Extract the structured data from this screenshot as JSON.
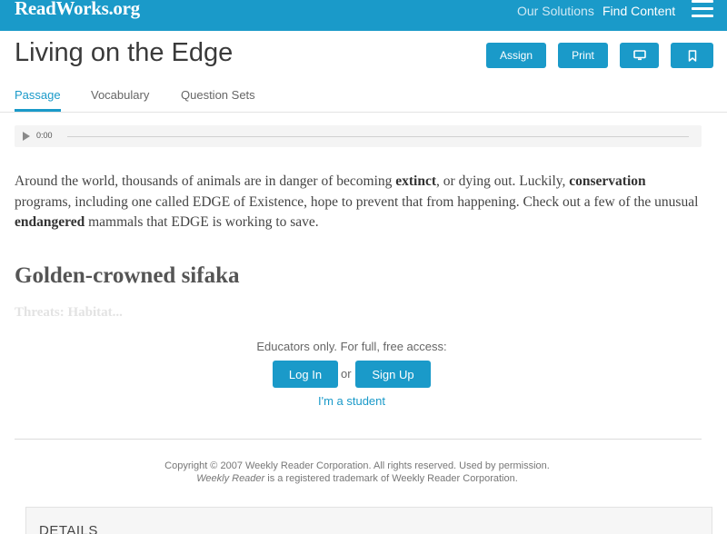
{
  "header": {
    "logo": "ReadWorks.org",
    "nav": {
      "solutions": "Our Solutions",
      "find_content": "Find Content"
    },
    "menu_icon": "hamburger-menu-icon"
  },
  "page": {
    "title": "Living on the Edge",
    "actions": {
      "assign": "Assign",
      "print": "Print",
      "present_icon": "monitor-icon",
      "bookmark_icon": "bookmark-icon"
    }
  },
  "tabs": [
    {
      "label": "Passage",
      "active": true
    },
    {
      "label": "Vocabulary",
      "active": false
    },
    {
      "label": "Question Sets",
      "active": false
    }
  ],
  "audio": {
    "time": "0:00",
    "play_icon": "play-icon"
  },
  "passage": {
    "p1": "Around the world, thousands of animals are in danger of becoming ",
    "k1": "extinct",
    "p2": ", or dying out. Luckily, ",
    "k2": "conservation",
    "p3": " programs, including one called EDGE of Existence, hope to prevent that from happening. Check out a few of the unusual ",
    "k3": "endangered",
    "p4": " mammals that EDGE is working to save.",
    "subheading": "Golden-crowned sifaka",
    "threats_teaser": "Threats: Habitat..."
  },
  "gate": {
    "message": "Educators only. For full, free access:",
    "login": "Log In",
    "or": "or",
    "signup": "Sign Up",
    "student": "I'm a student"
  },
  "footer": {
    "copyright": "Copyright © 2007 Weekly Reader Corporation. All rights reserved. Used by permission.",
    "trademark_name": "Weekly Reader",
    "trademark_rest": " is a registered trademark of Weekly Reader Corporation."
  },
  "details": {
    "label": "DETAILS"
  },
  "colors": {
    "brand": "#1a9ac9",
    "text": "#444444"
  }
}
